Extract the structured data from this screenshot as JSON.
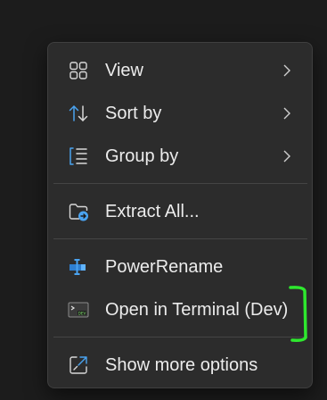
{
  "context_menu": {
    "items": [
      {
        "label": "View",
        "icon": "grid-icon",
        "has_submenu": true
      },
      {
        "label": "Sort by",
        "icon": "sort-arrows-icon",
        "has_submenu": true
      },
      {
        "label": "Group by",
        "icon": "group-list-icon",
        "has_submenu": true
      },
      {
        "label": "Extract All...",
        "icon": "folder-extract-icon",
        "has_submenu": false
      },
      {
        "label": "PowerRename",
        "icon": "powerrename-icon",
        "has_submenu": false
      },
      {
        "label": "Open in Terminal (Dev)",
        "icon": "terminal-dev-icon",
        "has_submenu": false
      },
      {
        "label": "Show more options",
        "icon": "show-more-icon",
        "has_submenu": false
      }
    ],
    "terminal_badge": "DEV"
  },
  "colors": {
    "background": "#1c1c1c",
    "menu_background": "#2c2c2c",
    "text": "#ececec",
    "accent_blue": "#4aa3f0",
    "highlight_green": "#2ee82e"
  }
}
